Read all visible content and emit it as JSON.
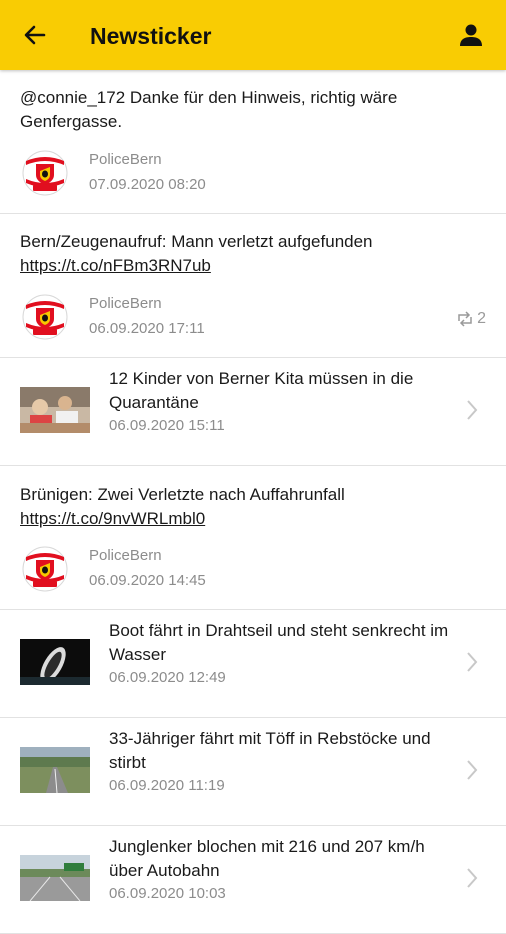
{
  "header": {
    "title": "Newsticker",
    "back_icon": "arrow-left-icon",
    "profile_icon": "person-icon",
    "background": "#f9cc03"
  },
  "feed": [
    {
      "type": "tweet",
      "text": "@connie_172 Danke für den Hinweis, richtig wäre Genfergasse.",
      "link": "",
      "author": "PoliceBern",
      "date": "07.09.2020 08:20",
      "retweets": ""
    },
    {
      "type": "tweet",
      "text": "Bern/Zeugenaufruf: Mann verletzt aufgefunden",
      "link": "https://t.co/nFBm3RN7ub",
      "author": "PoliceBern",
      "date": "06.09.2020 17:11",
      "retweets": "2"
    },
    {
      "type": "article",
      "title": "12 Kinder von Berner Kita müssen in die Quarantäne",
      "date": "06.09.2020 15:11",
      "thumb": "children-photo"
    },
    {
      "type": "tweet",
      "text": "Brünigen: Zwei Verletzte nach Auffahrunfall",
      "link": "https://t.co/9nvWRLmbl0",
      "author": "PoliceBern",
      "date": "06.09.2020 14:45",
      "retweets": ""
    },
    {
      "type": "article",
      "title": "Boot fährt in Drahtseil und steht senkrecht im Wasser",
      "date": "06.09.2020 12:49",
      "thumb": "boat-photo"
    },
    {
      "type": "article",
      "title": "33-Jähriger fährt mit Töff in Rebstöcke und stirbt",
      "date": "06.09.2020 11:19",
      "thumb": "road-photo"
    },
    {
      "type": "article",
      "title": "Junglenker blochen mit 216 und 207 km/h über Autobahn",
      "date": "06.09.2020 10:03",
      "thumb": "highway-photo"
    }
  ]
}
